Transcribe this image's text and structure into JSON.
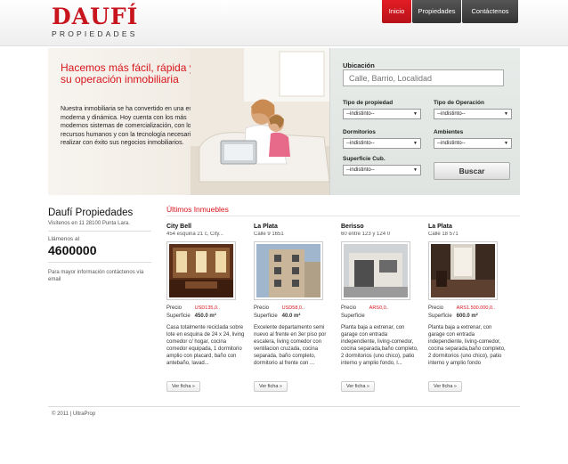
{
  "header": {
    "logo_main": "DAUFÍ",
    "logo_sub": "PROPIEDADES",
    "nav": [
      {
        "label": "Inicio",
        "active": true
      },
      {
        "label": "Propiedades",
        "active": false
      },
      {
        "label": "Contáctenos",
        "active": false
      }
    ]
  },
  "hero": {
    "title": "Hacemos más fácil, rápida y segura su operación inmobiliaria",
    "text": "Nuestra inmobiliaria se ha convertido en una empresa moderna y dinámica. Hoy cuenta con los más modernos sistemas de comercialización, con los recursos humanos y con la tecnología necesarios para realizar con éxito sus negocios inmobiliarios."
  },
  "search": {
    "ubicacion_label": "Ubicación",
    "ubicacion_placeholder": "Calle, Barrio, Localidad",
    "tipo_propiedad_label": "Tipo de propiedad",
    "tipo_propiedad_value": "--indistinto--",
    "tipo_operacion_label": "Tipo de Operación",
    "tipo_operacion_value": "--indistinto--",
    "dormitorios_label": "Dormitorios",
    "dormitorios_value": "--indistinto--",
    "ambientes_label": "Ambientes",
    "ambientes_value": "--indistinto--",
    "superficie_label": "Superficie Cub.",
    "superficie_value": "--indistinto--",
    "button": "Buscar"
  },
  "sidebar": {
    "title": "Daufí Propiedades",
    "address": "Visítenos en 11 28100 Punta Lara.",
    "call_label": "Llámenos al",
    "phone": "4600000",
    "info": "Para mayor información contáctenos vía email"
  },
  "listings": {
    "title": "Últimos Inmuebles",
    "price_label": "Precio",
    "surface_label": "Superficie",
    "button": "Ver ficha »",
    "items": [
      {
        "city": "City Bell",
        "address": "454 esquina 21 c, City...",
        "price": "USD135,0..",
        "surface": "450.0 m²",
        "desc": "Casa totalmente reciclada sobre lote en esquina de 24 x 24, living comedor c/ hogar, cocina comedor equipada, 1 dormitorio amplio con placard, baño con antebaño, lavad..."
      },
      {
        "city": "La Plata",
        "address": "Calle 9 1651",
        "price": "USD58,0..",
        "surface": "40.0 m²",
        "desc": "Excelente departamento semi nuevo al frente en 3er piso por escalera, living comedor con ventilacion cruzada, cocina separada, baño completo, dormitorio al frente con ..."
      },
      {
        "city": "Berisso",
        "address": "60 entre 123 y 124 0",
        "price": "ARS0,0..",
        "surface": "",
        "desc": "Planta baja a extrenar, con garage con entrada independiente, living-comedor, cocina separada,baño completo, 2 dormitorios (uno chico), patio interno y amplio fondo, l..."
      },
      {
        "city": "La Plata",
        "address": "Calle 18 571",
        "price": "ARS1.500.000,0..",
        "surface": "600.0 m²",
        "desc": "Planta baja a extrenar, con garage con entrada independiente, living-comedor, cocina separada,baño completo, 2 dormitorios (uno chico), patio interno y amplio fondo"
      }
    ]
  },
  "footer": {
    "text": "© 2011 | UltraProp"
  }
}
